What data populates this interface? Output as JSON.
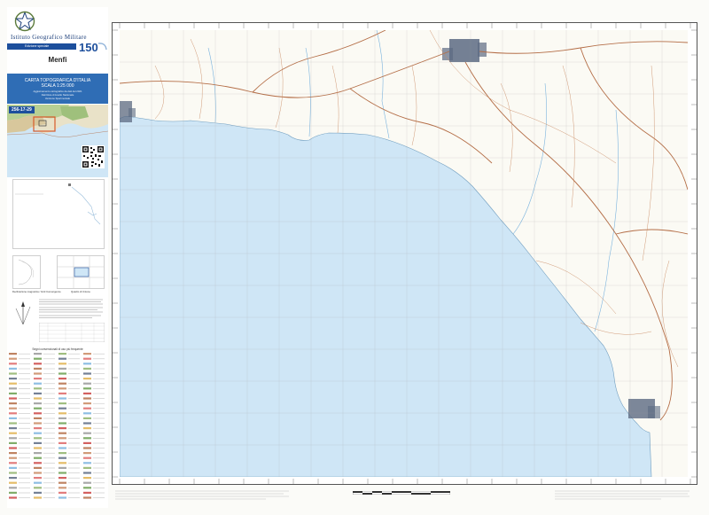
{
  "header": {
    "institute": "Istituto Geografico Militare",
    "edition_band": "Edizione speciale",
    "sheet_name": "Menfi"
  },
  "title_box": {
    "line1": "CARTA TOPOGRAFICA D'ITALIA",
    "line2": "SCALA 1:25 000",
    "line3": "Aggiornamento cartografico da dati del 2021",
    "line4": "Dati Rete di Livello Nazionale",
    "line5": "Versione Sperimentale"
  },
  "locator": {
    "sheet_code": "256-17-29"
  },
  "declination_caption": "Declinazione magnetica / Grid Convergence",
  "grid_caption": "Quadro di Unione",
  "legend": {
    "title": "Segni convenzionali di uso più frequente"
  },
  "colors": {
    "sea": "#cfe6f6",
    "land": "#fbfaf4",
    "roads": "#b46d46",
    "brand_blue": "#1d4f9c",
    "title_blue": "#2f6db5",
    "urban": "#5c6a82"
  },
  "icons": {
    "emblem": "republic-emblem-icon",
    "logo": "igm-150-logo",
    "qr": "qr-code-icon",
    "north": "north-arrow-icon"
  }
}
